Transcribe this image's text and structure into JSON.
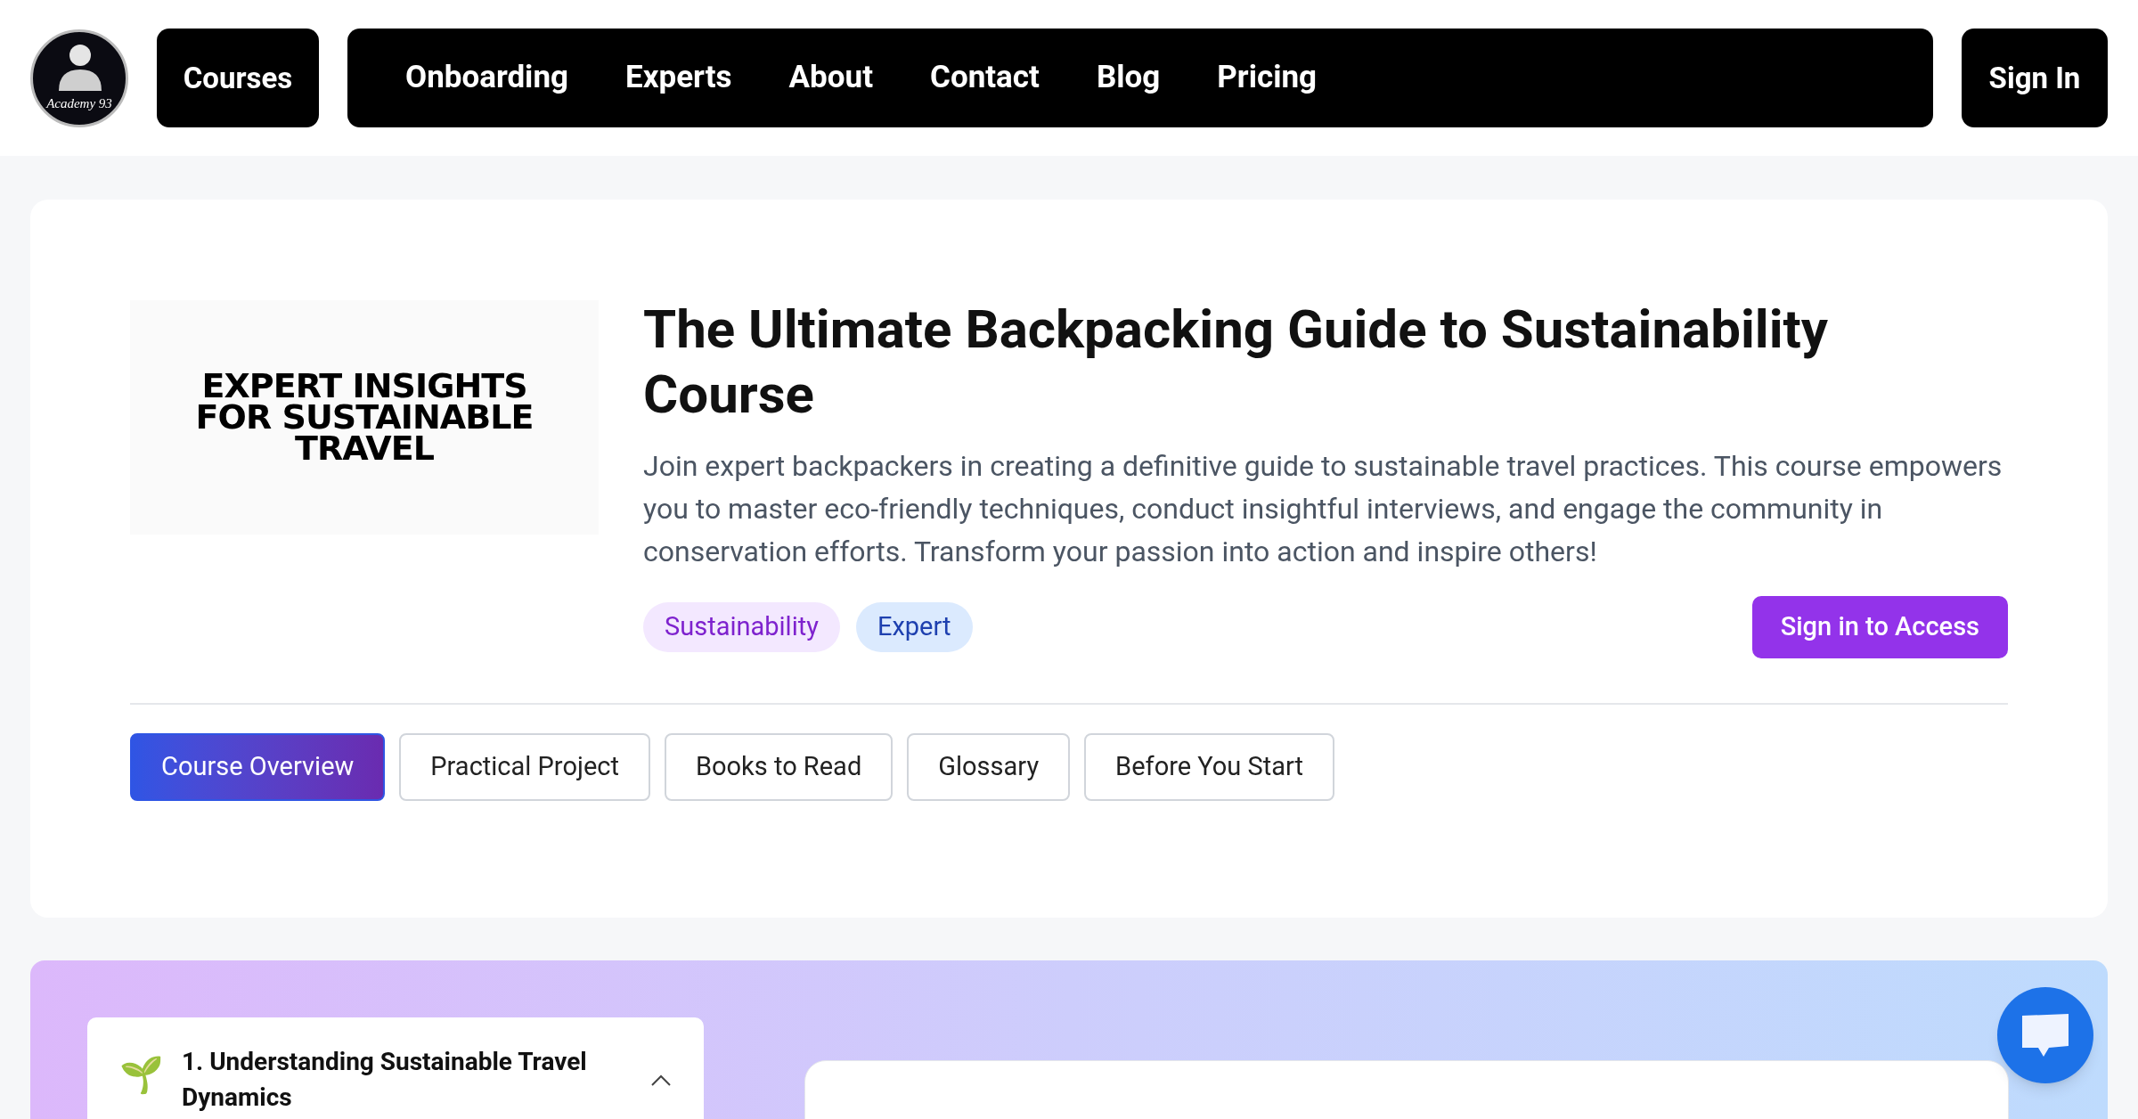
{
  "logo": {
    "text": "Academy 93"
  },
  "nav": {
    "courses": "Courses",
    "items": [
      "Onboarding",
      "Experts",
      "About",
      "Contact",
      "Blog",
      "Pricing"
    ],
    "sign_in": "Sign In"
  },
  "course": {
    "cover_text": [
      "EXPERT INSIGHTS",
      "FOR SUSTAINABLE",
      "TRAVEL"
    ],
    "title": "The Ultimate Backpacking Guide to Sustainability Course",
    "description": "Join expert backpackers in creating a definitive guide to sustainable travel practices. This course empowers you to master eco-friendly techniques, conduct insightful interviews, and engage the community in conservation efforts. Transform your passion into action and inspire others!",
    "tags": [
      {
        "label": "Sustainability",
        "color": "#f3e8ff"
      },
      {
        "label": "Expert",
        "color": "#dbeafe"
      }
    ],
    "access_button": "Sign in to Access"
  },
  "tabs": [
    {
      "label": "Course Overview",
      "selected": true
    },
    {
      "label": "Practical Project",
      "selected": false
    },
    {
      "label": "Books to Read",
      "selected": false
    },
    {
      "label": "Glossary",
      "selected": false
    },
    {
      "label": "Before You Start",
      "selected": false
    }
  ],
  "modules": [
    {
      "icon": "🌱",
      "title": "1. Understanding Sustainable Travel Dynamics",
      "expanded": true
    }
  ]
}
